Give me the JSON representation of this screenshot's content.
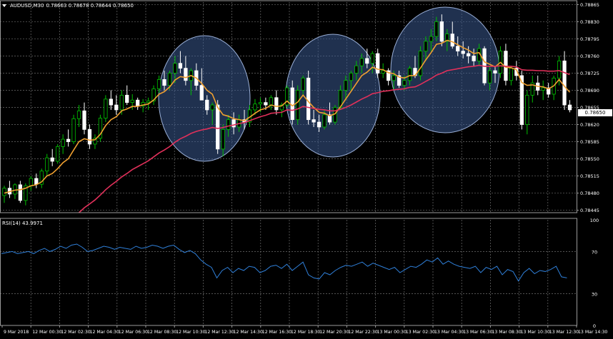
{
  "chart_title": {
    "symbol_tf": "AUDUSD,M30",
    "ohlc": "0.78663 0.78678 0.78644 0.78650"
  },
  "rsi_title": "RSI(14) 43.9971",
  "current_price_label": "0.78650",
  "colors": {
    "background": "#000000",
    "grid": "#6f6f6f",
    "candle_up": "#00c000",
    "candle_down": "#ffffff",
    "ma_fast": "#f0a030",
    "ma_slow": "#e0305a",
    "rsi_line": "#2f7fd8",
    "ellipse_fill": "#3a5a90",
    "ellipse_stroke": "#9bb0d8"
  },
  "chart_data": [
    {
      "type": "candlestick",
      "y_ticks": [
        "0.78865",
        "0.78830",
        "0.78795",
        "0.78760",
        "0.78725",
        "0.78690",
        "0.78655",
        "0.78620",
        "0.78585",
        "0.78550",
        "0.78515",
        "0.78480",
        "0.78445"
      ],
      "ylim": [
        0.7844,
        0.7887
      ],
      "x_labels": [
        "9 Mar 2018",
        "12 Mar 00:30",
        "12 Mar 02:30",
        "12 Mar 04:30",
        "12 Mar 06:30",
        "12 Mar 08:30",
        "12 Mar 10:30",
        "12 Mar 12:30",
        "12 Mar 14:30",
        "12 Mar 16:30",
        "12 Mar 18:30",
        "12 Mar 20:30",
        "12 Mar 22:30",
        "13 Mar 00:30",
        "13 Mar 02:30",
        "13 Mar 04:30",
        "13 Mar 06:30",
        "13 Mar 08:30",
        "13 Mar 10:30",
        "13 Mar 12:30",
        "13 Mar 14:30"
      ],
      "candles": [
        [
          0.78475,
          0.78495,
          0.7846,
          0.7849
        ],
        [
          0.7849,
          0.78505,
          0.7847,
          0.78478
        ],
        [
          0.78478,
          0.785,
          0.78468,
          0.78497
        ],
        [
          0.78497,
          0.78505,
          0.7846,
          0.78465
        ],
        [
          0.78465,
          0.785,
          0.78455,
          0.78495
        ],
        [
          0.78495,
          0.78515,
          0.78485,
          0.7851
        ],
        [
          0.7851,
          0.7852,
          0.7849,
          0.78498
        ],
        [
          0.78498,
          0.7853,
          0.7849,
          0.78525
        ],
        [
          0.78525,
          0.7856,
          0.78515,
          0.78552
        ],
        [
          0.78552,
          0.7857,
          0.78535,
          0.78545
        ],
        [
          0.78545,
          0.7858,
          0.7854,
          0.78575
        ],
        [
          0.78575,
          0.786,
          0.7856,
          0.7859
        ],
        [
          0.7859,
          0.7861,
          0.78575,
          0.78585
        ],
        [
          0.78585,
          0.7864,
          0.7858,
          0.78632
        ],
        [
          0.78632,
          0.7866,
          0.78615,
          0.78648
        ],
        [
          0.78648,
          0.78665,
          0.786,
          0.7861
        ],
        [
          0.7861,
          0.7862,
          0.7857,
          0.7858
        ],
        [
          0.7858,
          0.786,
          0.7857,
          0.78592
        ],
        [
          0.78592,
          0.7864,
          0.78585,
          0.78633
        ],
        [
          0.78633,
          0.7868,
          0.78625,
          0.78672
        ],
        [
          0.78672,
          0.7869,
          0.7865,
          0.7866
        ],
        [
          0.7866,
          0.7868,
          0.7864,
          0.7865
        ],
        [
          0.7865,
          0.7869,
          0.7864,
          0.7868
        ],
        [
          0.7868,
          0.787,
          0.7866,
          0.78665
        ],
        [
          0.78665,
          0.78682,
          0.7865,
          0.7867
        ],
        [
          0.7867,
          0.78675,
          0.7865,
          0.78658
        ],
        [
          0.78658,
          0.78672,
          0.78645,
          0.78665
        ],
        [
          0.78665,
          0.78675,
          0.7865,
          0.78668
        ],
        [
          0.78668,
          0.787,
          0.7866,
          0.78693
        ],
        [
          0.78693,
          0.7872,
          0.78685,
          0.78712
        ],
        [
          0.78712,
          0.7873,
          0.7869,
          0.787
        ],
        [
          0.787,
          0.7873,
          0.7869,
          0.78725
        ],
        [
          0.78725,
          0.7876,
          0.78705,
          0.78745
        ],
        [
          0.78745,
          0.7877,
          0.78725,
          0.78735
        ],
        [
          0.78735,
          0.7876,
          0.787,
          0.7871
        ],
        [
          0.7871,
          0.78735,
          0.7868,
          0.7873
        ],
        [
          0.7873,
          0.78745,
          0.7869,
          0.787
        ],
        [
          0.787,
          0.78735,
          0.7867,
          0.7867
        ],
        [
          0.7867,
          0.7868,
          0.7864,
          0.7865
        ],
        [
          0.7865,
          0.78665,
          0.7862,
          0.7866
        ],
        [
          0.7866,
          0.7867,
          0.7856,
          0.7857
        ],
        [
          0.7857,
          0.7862,
          0.78555,
          0.7861
        ],
        [
          0.7861,
          0.7864,
          0.78595,
          0.7863
        ],
        [
          0.7863,
          0.78645,
          0.786,
          0.78615
        ],
        [
          0.78615,
          0.7864,
          0.78605,
          0.7863
        ],
        [
          0.7863,
          0.7865,
          0.7861,
          0.78625
        ],
        [
          0.78625,
          0.7866,
          0.78615,
          0.7865
        ],
        [
          0.7865,
          0.78672,
          0.7864,
          0.78662
        ],
        [
          0.78662,
          0.78675,
          0.78645,
          0.78665
        ],
        [
          0.78665,
          0.78675,
          0.7865,
          0.7866
        ],
        [
          0.7866,
          0.7868,
          0.7865,
          0.78675
        ],
        [
          0.78675,
          0.7869,
          0.7864,
          0.7865
        ],
        [
          0.7865,
          0.78665,
          0.78635,
          0.7866
        ],
        [
          0.7866,
          0.787,
          0.78655,
          0.78695
        ],
        [
          0.78695,
          0.7871,
          0.7862,
          0.7863
        ],
        [
          0.7863,
          0.787,
          0.7862,
          0.7869
        ],
        [
          0.7869,
          0.7872,
          0.7868,
          0.78715
        ],
        [
          0.78715,
          0.7873,
          0.7862,
          0.7863
        ],
        [
          0.7863,
          0.7865,
          0.78615,
          0.78625
        ],
        [
          0.78625,
          0.7864,
          0.78605,
          0.78615
        ],
        [
          0.78615,
          0.7865,
          0.7861,
          0.7864
        ],
        [
          0.7864,
          0.78665,
          0.7862,
          0.78625
        ],
        [
          0.78625,
          0.7866,
          0.7862,
          0.78655
        ],
        [
          0.78655,
          0.787,
          0.7865,
          0.7869
        ],
        [
          0.7869,
          0.7872,
          0.7867,
          0.7871
        ],
        [
          0.7871,
          0.7873,
          0.7869,
          0.78725
        ],
        [
          0.78725,
          0.7875,
          0.7871,
          0.7874
        ],
        [
          0.7874,
          0.78765,
          0.78725,
          0.78755
        ],
        [
          0.78755,
          0.78775,
          0.78735,
          0.78745
        ],
        [
          0.78745,
          0.7877,
          0.78725,
          0.78765
        ],
        [
          0.78765,
          0.78775,
          0.78715,
          0.78725
        ],
        [
          0.78725,
          0.78745,
          0.78715,
          0.7873
        ],
        [
          0.7873,
          0.78735,
          0.787,
          0.7871
        ],
        [
          0.7871,
          0.7873,
          0.7869,
          0.7872
        ],
        [
          0.7872,
          0.7873,
          0.78695,
          0.787
        ],
        [
          0.787,
          0.7872,
          0.7869,
          0.7871
        ],
        [
          0.7871,
          0.7874,
          0.787,
          0.78735
        ],
        [
          0.78735,
          0.7876,
          0.78715,
          0.7872
        ],
        [
          0.7872,
          0.7878,
          0.7871,
          0.7877
        ],
        [
          0.7877,
          0.788,
          0.7875,
          0.7879
        ],
        [
          0.7879,
          0.78815,
          0.7877,
          0.788
        ],
        [
          0.788,
          0.7884,
          0.7879,
          0.7883
        ],
        [
          0.7883,
          0.78845,
          0.7878,
          0.7879
        ],
        [
          0.7879,
          0.78815,
          0.7877,
          0.78805
        ],
        [
          0.78805,
          0.7883,
          0.78775,
          0.7878
        ],
        [
          0.7878,
          0.788,
          0.7876,
          0.7877
        ],
        [
          0.7877,
          0.7879,
          0.78755,
          0.78765
        ],
        [
          0.78765,
          0.7878,
          0.78745,
          0.7876
        ],
        [
          0.7876,
          0.78775,
          0.7874,
          0.7875
        ],
        [
          0.7875,
          0.78785,
          0.7874,
          0.78775
        ],
        [
          0.78775,
          0.7878,
          0.787,
          0.78705
        ],
        [
          0.78705,
          0.7874,
          0.7869,
          0.7873
        ],
        [
          0.7873,
          0.7874,
          0.78705,
          0.78725
        ],
        [
          0.78725,
          0.7878,
          0.78715,
          0.7877
        ],
        [
          0.7877,
          0.78785,
          0.787,
          0.7871
        ],
        [
          0.7871,
          0.7874,
          0.787,
          0.78735
        ],
        [
          0.78735,
          0.7875,
          0.7871,
          0.7872
        ],
        [
          0.7872,
          0.7873,
          0.7861,
          0.7862
        ],
        [
          0.7862,
          0.7869,
          0.786,
          0.7868
        ],
        [
          0.7868,
          0.7872,
          0.78665,
          0.78705
        ],
        [
          0.78705,
          0.7872,
          0.7868,
          0.7869
        ],
        [
          0.7869,
          0.7871,
          0.7867,
          0.78695
        ],
        [
          0.78695,
          0.78705,
          0.78675,
          0.78682
        ],
        [
          0.78682,
          0.7872,
          0.7867,
          0.78715
        ],
        [
          0.78715,
          0.7876,
          0.787,
          0.7875
        ],
        [
          0.7875,
          0.7877,
          0.7865,
          0.7866
        ],
        [
          0.7866,
          0.7867,
          0.78645,
          0.7865
        ]
      ],
      "series": [
        {
          "name": "",
          "type": "line",
          "color": "#f0a030",
          "values": [
            0.7848,
            0.78483,
            0.78486,
            0.78487,
            0.7849,
            0.78495,
            0.78497,
            0.78503,
            0.78515,
            0.7852,
            0.7853,
            0.78542,
            0.7855,
            0.78568,
            0.78585,
            0.78591,
            0.78588,
            0.78589,
            0.786,
            0.78618,
            0.7863,
            0.78636,
            0.78648,
            0.78652,
            0.78657,
            0.78657,
            0.7866,
            0.78662,
            0.7867,
            0.78682,
            0.78687,
            0.78697,
            0.78711,
            0.78718,
            0.78716,
            0.7872,
            0.78715,
            0.78704,
            0.7869,
            0.78682,
            0.78655,
            0.7864,
            0.78637,
            0.78632,
            0.7863,
            0.78628,
            0.78635,
            0.78643,
            0.7865,
            0.78653,
            0.7866,
            0.78657,
            0.78658,
            0.78668,
            0.78658,
            0.78666,
            0.7868,
            0.78667,
            0.78655,
            0.78645,
            0.78643,
            0.78638,
            0.78642,
            0.78656,
            0.78672,
            0.78688,
            0.78704,
            0.7872,
            0.78727,
            0.78737,
            0.78733,
            0.78732,
            0.78726,
            0.78724,
            0.78717,
            0.78715,
            0.7872,
            0.7872,
            0.78735,
            0.78752,
            0.78767,
            0.78784,
            0.78786,
            0.78792,
            0.78789,
            0.78783,
            0.78777,
            0.78772,
            0.78765,
            0.78767,
            0.78748,
            0.78743,
            0.78738,
            0.78747,
            0.78737,
            0.78736,
            0.78732,
            0.78706,
            0.787,
            0.78701,
            0.78698,
            0.78697,
            0.78693,
            0.78699,
            0.78712,
            0.78698,
            0.78686
          ]
        },
        {
          "name": "",
          "type": "line",
          "color": "#e0305a",
          "values": [
            null,
            null,
            null,
            null,
            null,
            null,
            null,
            null,
            null,
            null,
            null,
            null,
            null,
            null,
            0.7844,
            0.7845,
            0.78458,
            0.78466,
            0.78476,
            0.78487,
            0.78496,
            0.78504,
            0.78513,
            0.7852,
            0.78528,
            0.78534,
            0.7854,
            0.78546,
            0.78554,
            0.78562,
            0.78568,
            0.78575,
            0.78584,
            0.78591,
            0.78596,
            0.78602,
            0.78606,
            0.78609,
            0.78611,
            0.78614,
            0.78612,
            0.78614,
            0.78617,
            0.78619,
            0.78622,
            0.78624,
            0.78628,
            0.78632,
            0.78636,
            0.78639,
            0.78643,
            0.78644,
            0.78645,
            0.7865,
            0.78649,
            0.78652,
            0.78657,
            0.78655,
            0.78653,
            0.78651,
            0.7865,
            0.78648,
            0.78648,
            0.78651,
            0.78655,
            0.7866,
            0.78666,
            0.78672,
            0.78677,
            0.78683,
            0.78685,
            0.78688,
            0.78689,
            0.78691,
            0.78692,
            0.78693,
            0.78696,
            0.78697,
            0.78702,
            0.78708,
            0.78714,
            0.78721,
            0.78725,
            0.7873,
            0.78732,
            0.78734,
            0.78736,
            0.78738,
            0.78739,
            0.78741,
            0.78739,
            0.78739,
            0.78739,
            0.7874,
            0.78739,
            0.78739,
            0.78738,
            0.78732,
            0.78731,
            0.78731,
            0.7873,
            0.7873,
            0.78729,
            0.78729,
            0.7873,
            0.78726,
            0.78722
          ]
        }
      ]
    },
    {
      "type": "line",
      "name": "RSI(14)",
      "y_ticks": [
        "100",
        "70",
        "30",
        "0"
      ],
      "ylim": [
        0,
        100
      ],
      "levels": [
        70,
        30
      ],
      "values": [
        68,
        69,
        70,
        68,
        69,
        70,
        68,
        71,
        73,
        70,
        72,
        75,
        73,
        76,
        77,
        74,
        70,
        71,
        73,
        75,
        74,
        72,
        74,
        73,
        72,
        75,
        73,
        74,
        76,
        75,
        73,
        75,
        76,
        72,
        69,
        71,
        68,
        62,
        58,
        55,
        45,
        52,
        55,
        50,
        54,
        52,
        56,
        55,
        50,
        52,
        56,
        57,
        54,
        58,
        52,
        56,
        60,
        48,
        45,
        44,
        50,
        48,
        52,
        55,
        57,
        56,
        58,
        60,
        56,
        59,
        57,
        55,
        53,
        55,
        50,
        53,
        56,
        55,
        58,
        62,
        60,
        64,
        58,
        61,
        58,
        56,
        55,
        54,
        56,
        50,
        55,
        53,
        56,
        48,
        53,
        51,
        42,
        50,
        54,
        49,
        52,
        51,
        53,
        56,
        46,
        45
      ]
    }
  ]
}
